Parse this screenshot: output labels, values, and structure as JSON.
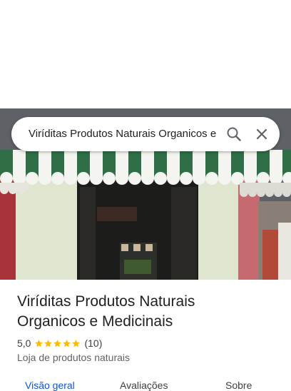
{
  "search": {
    "query": "Viríditas Produtos Naturais Organicos e Medicinais",
    "search_icon": "search-icon",
    "close_icon": "close-icon"
  },
  "place": {
    "name": "Viríditas Produtos Naturais Organicos e Medicinais",
    "rating": "5,0",
    "stars": 5,
    "review_count": "(10)",
    "category": "Loja de produtos naturais"
  },
  "tabs": [
    {
      "label": "Visão geral",
      "active": true
    },
    {
      "label": "Avaliações",
      "active": false
    },
    {
      "label": "Sobre",
      "active": false
    }
  ],
  "colors": {
    "accent": "#0b57d0",
    "star": "#fbbc04",
    "awning_green": "#2f6e47",
    "awning_white": "#f4f4f0"
  }
}
